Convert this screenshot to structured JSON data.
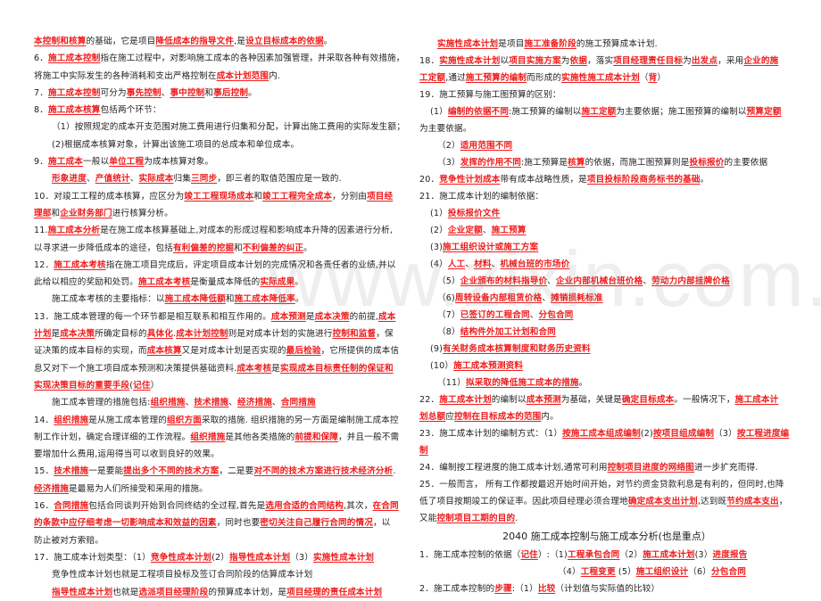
{
  "watermark": "www.zixin.com.cn",
  "left_column": [
    {
      "indent": 0,
      "segs": [
        {
          "h": 1,
          "t": "本控制和核算"
        },
        {
          "t": "的基础，它是项目"
        },
        {
          "h": 1,
          "t": "降低成本的指导文件"
        },
        {
          "t": ",是"
        },
        {
          "h": 1,
          "t": "设立目标成本的依据"
        },
        {
          "t": "。"
        }
      ]
    },
    {
      "indent": 0,
      "segs": [
        {
          "t": "6．"
        },
        {
          "h": 1,
          "t": "施工成本控制"
        },
        {
          "t": "指在施工过程中，对影响施工成本的各种因素加强管理，并采取各种有效措施，"
        }
      ]
    },
    {
      "indent": 0,
      "segs": [
        {
          "t": "将施工中实际发生的各种消耗和支出严格控制在"
        },
        {
          "h": 1,
          "t": "成本计划范围"
        },
        {
          "t": "内."
        }
      ]
    },
    {
      "indent": 0,
      "segs": [
        {
          "t": "7．"
        },
        {
          "h": 1,
          "t": "施工成本控制"
        },
        {
          "t": "可分为"
        },
        {
          "h": 1,
          "t": "事先控制"
        },
        {
          "t": "、"
        },
        {
          "h": 1,
          "t": "事中控制"
        },
        {
          "t": "和"
        },
        {
          "h": 1,
          "t": "事后控制"
        },
        {
          "t": "。"
        }
      ]
    },
    {
      "indent": 0,
      "segs": [
        {
          "t": "8．"
        },
        {
          "h": 1,
          "t": "施工成本核算"
        },
        {
          "t": "包括两个环节："
        }
      ]
    },
    {
      "indent": 1,
      "segs": [
        {
          "t": "（1）按照规定的成本开支范围对施工费用进行归集和分配，计算出施工费用的实际发生额；"
        }
      ]
    },
    {
      "indent": 1,
      "segs": [
        {
          "t": "(2)根据成本核算对象，计算出该施工项目的总成本和单位成本。"
        }
      ]
    },
    {
      "indent": 0,
      "segs": [
        {
          "t": "9．"
        },
        {
          "h": 1,
          "t": "施工成本"
        },
        {
          "t": "一般以"
        },
        {
          "h": 1,
          "t": "单位工程"
        },
        {
          "t": "为成本核算对象。"
        }
      ]
    },
    {
      "indent": 1,
      "segs": [
        {
          "h": 1,
          "t": "形象进度"
        },
        {
          "t": "、"
        },
        {
          "h": 1,
          "t": "产值统计"
        },
        {
          "t": "、"
        },
        {
          "h": 1,
          "t": "实际成本"
        },
        {
          "t": "归集"
        },
        {
          "h": 1,
          "t": "三同步"
        },
        {
          "t": "，即三者的取值范围应是一致的."
        }
      ]
    },
    {
      "indent": 0,
      "segs": [
        {
          "t": "10．对竣工工程的成本核算，应区分为"
        },
        {
          "h": 1,
          "t": "竣工工程现场成本"
        },
        {
          "t": "和"
        },
        {
          "h": 1,
          "t": "竣工工程完全成本"
        },
        {
          "t": "，分别由"
        },
        {
          "h": 1,
          "t": "项目经"
        }
      ]
    },
    {
      "indent": 0,
      "segs": [
        {
          "h": 1,
          "t": "理部"
        },
        {
          "t": "和"
        },
        {
          "h": 1,
          "t": "企业财务部门"
        },
        {
          "t": "进行核算分析。"
        }
      ]
    },
    {
      "indent": 0,
      "segs": [
        {
          "t": "11."
        },
        {
          "h": 1,
          "t": "施工成本分析"
        },
        {
          "t": "是在施工成本核算基础上,对成本的形成过程和影响成本升降的因素进行分析,"
        }
      ]
    },
    {
      "indent": 0,
      "segs": [
        {
          "t": "以寻求进一步降低成本的途径，包括"
        },
        {
          "h": 1,
          "t": "有利偏差的挖掘"
        },
        {
          "t": "和"
        },
        {
          "h": 1,
          "t": "不利偏差的纠正"
        },
        {
          "t": "。"
        }
      ]
    },
    {
      "indent": 0,
      "segs": [
        {
          "t": "12．"
        },
        {
          "h": 1,
          "t": "施工成本考核"
        },
        {
          "t": "指在施工项目完成后，评定项目成本计划的完成情况和各责任者的业绩,并以"
        }
      ]
    },
    {
      "indent": 0,
      "segs": [
        {
          "t": "此给以相应的奖励和处罚。"
        },
        {
          "h": 1,
          "t": "施工成本考核"
        },
        {
          "t": "是衡量成本降低的"
        },
        {
          "h": 1,
          "t": "实际成果"
        },
        {
          "t": "。"
        }
      ]
    },
    {
      "indent": 1,
      "segs": [
        {
          "t": "施工成本考核的主要指标：以"
        },
        {
          "h": 1,
          "t": "施工成本降低额"
        },
        {
          "t": "和"
        },
        {
          "h": 1,
          "t": "施工成本降低率"
        },
        {
          "t": "。"
        }
      ]
    },
    {
      "indent": 0,
      "segs": [
        {
          "t": "13．施工成本管理的每一个环节都是相互联系和相互作用的。"
        },
        {
          "h": 1,
          "t": "成本预测"
        },
        {
          "t": "是"
        },
        {
          "h": 1,
          "t": "成本决策"
        },
        {
          "t": "的前提,"
        },
        {
          "h": 1,
          "t": "成本"
        }
      ]
    },
    {
      "indent": 0,
      "segs": [
        {
          "h": 1,
          "t": "计划"
        },
        {
          "t": "是"
        },
        {
          "h": 1,
          "t": "成本决策"
        },
        {
          "t": "所确定目标的"
        },
        {
          "h": 1,
          "t": "具体化"
        },
        {
          "t": "."
        },
        {
          "h": 1,
          "t": "成本计划控制"
        },
        {
          "t": "则是对成本计划的实施进行"
        },
        {
          "h": 1,
          "t": "控制和监督"
        },
        {
          "t": "，保"
        }
      ]
    },
    {
      "indent": 0,
      "segs": [
        {
          "t": "证决策的成本目标的实现，而"
        },
        {
          "h": 1,
          "t": "成本核算"
        },
        {
          "t": "又是对成本计划是否实现的"
        },
        {
          "h": 1,
          "t": "最后检验"
        },
        {
          "t": "，它所提供的成本信"
        }
      ]
    },
    {
      "indent": 0,
      "segs": [
        {
          "t": "息又对下一个施工项目成本预测和决策提供基础资料."
        },
        {
          "h": 1,
          "t": "成本考核"
        },
        {
          "t": "是"
        },
        {
          "h": 1,
          "t": "实现成本目标责任制的保证和"
        }
      ]
    },
    {
      "indent": 0,
      "segs": [
        {
          "h": 1,
          "t": "实现决策目标的重要手段"
        },
        {
          "t": "("
        },
        {
          "h": 1,
          "t": "记住"
        },
        {
          "t": "）"
        }
      ]
    },
    {
      "indent": 1,
      "segs": [
        {
          "t": "施工成本管理的措施包括:"
        },
        {
          "h": 1,
          "t": "组织措施"
        },
        {
          "t": "、"
        },
        {
          "h": 1,
          "t": "技术措施"
        },
        {
          "t": "、"
        },
        {
          "h": 1,
          "t": "经济措施"
        },
        {
          "t": "、"
        },
        {
          "h": 1,
          "t": "合同措施"
        }
      ]
    },
    {
      "indent": 0,
      "segs": [
        {
          "t": "14．"
        },
        {
          "h": 1,
          "t": "组织措施"
        },
        {
          "t": "是从施工成本管理的"
        },
        {
          "h": 1,
          "t": "组织方面"
        },
        {
          "t": "采取的措施. 组织措施的另一方面是编制施工成本控"
        }
      ]
    },
    {
      "indent": 0,
      "segs": [
        {
          "t": "制工作计划，确定合理详细的工作流程。"
        },
        {
          "h": 1,
          "t": "组织措施"
        },
        {
          "t": "是其他各类措施的"
        },
        {
          "h": 1,
          "t": "前提和保障"
        },
        {
          "t": "，并且一般不需"
        }
      ]
    },
    {
      "indent": 0,
      "segs": [
        {
          "t": "要增加什么费用,运用得当可以收到良好的效果。"
        }
      ]
    },
    {
      "indent": 0,
      "segs": [
        {
          "t": "15．"
        },
        {
          "h": 1,
          "t": "技术措施"
        },
        {
          "t": "一是要能"
        },
        {
          "h": 1,
          "t": "提出多个不同的技术方案"
        },
        {
          "t": "，二是要"
        },
        {
          "h": 1,
          "t": "对不同的技术方案进行技术经济分析"
        },
        {
          "t": "."
        }
      ]
    },
    {
      "indent": 0,
      "segs": [
        {
          "h": 1,
          "t": "经济措施"
        },
        {
          "t": "是最易为人们所接受和采用的措施。"
        }
      ]
    },
    {
      "indent": 0,
      "segs": [
        {
          "t": "16．"
        },
        {
          "h": 1,
          "t": "合同措施"
        },
        {
          "t": "包括合同谈判开始到合同终结的全过程,首先是"
        },
        {
          "h": 1,
          "t": "选用合适的合同结构"
        },
        {
          "t": ",其次，"
        },
        {
          "h": 1,
          "t": "在合同"
        }
      ]
    },
    {
      "indent": 0,
      "segs": [
        {
          "h": 1,
          "t": "的条款中应仔细考虑一切影响成本和效益的因素"
        },
        {
          "t": "，同时也要"
        },
        {
          "h": 1,
          "t": "密切关注自己履行合同的情况"
        },
        {
          "t": "，以"
        }
      ]
    },
    {
      "indent": 0,
      "segs": [
        {
          "t": "防止被对方索赔。"
        }
      ]
    },
    {
      "indent": 0,
      "segs": [
        {
          "t": "17．施工成本计划类型：（1）"
        },
        {
          "h": 1,
          "t": "竞争性成本计划"
        },
        {
          "t": "(2）"
        },
        {
          "h": 1,
          "t": "指导性成本计划"
        },
        {
          "t": "（3）"
        },
        {
          "h": 1,
          "t": "实施性成本计划"
        }
      ]
    },
    {
      "indent": 1,
      "segs": [
        {
          "t": "竞争性成本计划也就是工程项目投标及签订合同阶段的估算成本计划"
        }
      ]
    },
    {
      "indent": 1,
      "segs": [
        {
          "h": 1,
          "t": "指导性成本计划"
        },
        {
          "t": "也就是"
        },
        {
          "h": 1,
          "t": "选派项目经理阶段"
        },
        {
          "t": "的预算成本计划，是"
        },
        {
          "h": 1,
          "t": "项目经理的责任成本计划"
        }
      ]
    }
  ],
  "right_column": [
    {
      "indent": 1,
      "segs": [
        {
          "h": 1,
          "t": "实施性成本计划"
        },
        {
          "t": "是项目"
        },
        {
          "h": 1,
          "t": "施工准备阶段"
        },
        {
          "t": "的施工预算成本计划."
        }
      ]
    },
    {
      "indent": 0,
      "segs": [
        {
          "t": "18．"
        },
        {
          "h": 1,
          "t": "实施性成本计划"
        },
        {
          "t": "以"
        },
        {
          "h": 1,
          "t": "项目实施方案"
        },
        {
          "t": "为"
        },
        {
          "h": 1,
          "t": "依据"
        },
        {
          "t": "，落实"
        },
        {
          "h": 1,
          "t": "项目经理责任目标"
        },
        {
          "t": "为"
        },
        {
          "h": 1,
          "t": "出发点"
        },
        {
          "t": "，采用"
        },
        {
          "h": 1,
          "t": "企业的施"
        }
      ]
    },
    {
      "indent": 0,
      "segs": [
        {
          "h": 1,
          "t": "工定额"
        },
        {
          "t": ",通过"
        },
        {
          "h": 1,
          "t": "施工预算的编制"
        },
        {
          "t": "而形成的"
        },
        {
          "h": 1,
          "t": "实施性施工成本计划"
        },
        {
          "t": "（"
        },
        {
          "h": 1,
          "t": "背"
        },
        {
          "t": "）"
        }
      ]
    },
    {
      "indent": 0,
      "segs": [
        {
          "t": "19．施工预算与施工图预算的区别："
        }
      ]
    },
    {
      "indent": 2,
      "segs": [
        {
          "t": "(1）"
        },
        {
          "h": 1,
          "t": "编制的依据不同"
        },
        {
          "t": ":施工预算的编制以"
        },
        {
          "h": 1,
          "t": "施工定额"
        },
        {
          "t": "为主要依据；施工图预算的编制以"
        },
        {
          "h": 1,
          "t": "预算定额"
        }
      ]
    },
    {
      "indent": 0,
      "segs": [
        {
          "t": "为主要依据。"
        }
      ]
    },
    {
      "indent": 3,
      "segs": [
        {
          "t": "（2）"
        },
        {
          "h": 1,
          "t": "适用范围不同"
        }
      ]
    },
    {
      "indent": 3,
      "segs": [
        {
          "t": "（3）"
        },
        {
          "h": 1,
          "t": "发挥的作用不同"
        },
        {
          "t": ":施工预算是"
        },
        {
          "h": 1,
          "t": "核算"
        },
        {
          "t": "的依据，而施工图预算则是"
        },
        {
          "h": 1,
          "t": "投标报价"
        },
        {
          "t": "的主要依据"
        }
      ]
    },
    {
      "indent": 0,
      "segs": [
        {
          "t": "20．"
        },
        {
          "h": 1,
          "t": "竞争性计划成本"
        },
        {
          "t": "带有成本战略性质，是"
        },
        {
          "h": 1,
          "t": "项目投标阶段商务标书的基础"
        },
        {
          "t": "。"
        }
      ]
    },
    {
      "indent": 0,
      "segs": [
        {
          "t": "21．施工成本计划的编制依据："
        }
      ]
    },
    {
      "indent": 2,
      "segs": [
        {
          "t": "(1）"
        },
        {
          "h": 1,
          "t": "投标报价文件"
        }
      ]
    },
    {
      "indent": 2,
      "segs": [
        {
          "t": "(2）"
        },
        {
          "h": 1,
          "t": "企业定额"
        },
        {
          "t": "、"
        },
        {
          "h": 1,
          "t": "施工预算"
        }
      ]
    },
    {
      "indent": 2,
      "segs": [
        {
          "t": "(3)"
        },
        {
          "h": 1,
          "t": "施工组织设计或施工方案"
        }
      ]
    },
    {
      "indent": 2,
      "segs": [
        {
          "t": "(4）"
        },
        {
          "h": 1,
          "t": "人工"
        },
        {
          "t": "、"
        },
        {
          "h": 1,
          "t": "材料"
        },
        {
          "t": "、"
        },
        {
          "h": 1,
          "t": "机械台班的市场价"
        }
      ]
    },
    {
      "indent": 3,
      "segs": [
        {
          "t": "（5）"
        },
        {
          "h": 1,
          "t": "企业颁布的材料指导价"
        },
        {
          "t": "、"
        },
        {
          "h": 1,
          "t": "企业内部机械台班价格"
        },
        {
          "t": "、"
        },
        {
          "h": 1,
          "t": "劳动力内部挂牌价格"
        }
      ]
    },
    {
      "indent": 3,
      "segs": [
        {
          "t": "（6)"
        },
        {
          "h": 1,
          "t": "周转设备内部租赁价格"
        },
        {
          "t": "、"
        },
        {
          "h": 1,
          "t": "摊销损耗标准"
        }
      ]
    },
    {
      "indent": 3,
      "segs": [
        {
          "t": "（7）"
        },
        {
          "h": 1,
          "t": "已签订的工程合同"
        },
        {
          "t": "、"
        },
        {
          "h": 1,
          "t": "分包合同"
        }
      ]
    },
    {
      "indent": 3,
      "segs": [
        {
          "t": "（8）"
        },
        {
          "h": 1,
          "t": "结构件外加工计划和合同"
        }
      ]
    },
    {
      "indent": 2,
      "segs": [
        {
          "t": "(9)"
        },
        {
          "h": 1,
          "t": "有关财务成本核算制度和财务历史资料"
        }
      ]
    },
    {
      "indent": 2,
      "segs": [
        {
          "t": "(10）"
        },
        {
          "h": 1,
          "t": "施工成本预测资料"
        }
      ]
    },
    {
      "indent": 3,
      "segs": [
        {
          "t": "（11）"
        },
        {
          "h": 1,
          "t": "拟采取的降低施工成本的措施"
        },
        {
          "t": "。"
        }
      ]
    },
    {
      "indent": 0,
      "segs": [
        {
          "t": "22．"
        },
        {
          "h": 1,
          "t": "施工成本计划"
        },
        {
          "t": "的编制以"
        },
        {
          "h": 1,
          "t": "成本预测"
        },
        {
          "t": "为基础，关键是"
        },
        {
          "h": 1,
          "t": "确定目标成本"
        },
        {
          "t": "。一般情况下，"
        },
        {
          "h": 1,
          "t": "施工成本计"
        }
      ]
    },
    {
      "indent": 0,
      "segs": [
        {
          "h": 1,
          "t": "划总额"
        },
        {
          "t": "应"
        },
        {
          "h": 1,
          "t": "控制在目标成本的范围"
        },
        {
          "t": "内。"
        }
      ]
    },
    {
      "indent": 0,
      "segs": [
        {
          "t": "23．施工成本计划的编制方式：（1）"
        },
        {
          "h": 1,
          "t": "按施工成本组成编制"
        },
        {
          "t": "(2)"
        },
        {
          "h": 1,
          "t": "按项目组成编制"
        },
        {
          "t": "（3）"
        },
        {
          "h": 1,
          "t": "按工程进度编"
        }
      ]
    },
    {
      "indent": 0,
      "segs": [
        {
          "h": 1,
          "t": "制"
        }
      ]
    },
    {
      "indent": 0,
      "segs": [
        {
          "t": "24．编制按工程进度的施工成本计划,通常可利用"
        },
        {
          "h": 1,
          "t": "控制项目进度的网络图"
        },
        {
          "t": "进一步扩充而得."
        }
      ]
    },
    {
      "indent": 0,
      "segs": [
        {
          "t": "25．一般而言，  所有工作都按最迟开始时间开始，对节约资金贷款利息是有利的，但同时,也降"
        }
      ]
    },
    {
      "indent": 0,
      "segs": [
        {
          "t": "低了项目按期竣工的保证率。因此项目经理必须合理地"
        },
        {
          "h": 1,
          "t": "确定成本支出计划"
        },
        {
          "t": ",达到既"
        },
        {
          "h": 1,
          "t": "节约成本支出"
        },
        {
          "t": "，"
        }
      ]
    },
    {
      "indent": 0,
      "segs": [
        {
          "t": "又能"
        },
        {
          "h": 1,
          "t": "控制项目工期的目的"
        },
        {
          "t": "."
        }
      ]
    }
  ],
  "section": {
    "heading": "2040  施工成本控制与施工成本分析(也是重点）",
    "lines": [
      {
        "indent": 0,
        "segs": [
          {
            "t": "1．施工成本控制的依据（"
          },
          {
            "h": 1,
            "t": "记住"
          },
          {
            "t": "）:（1)"
          },
          {
            "h": 1,
            "t": "工程承包合同"
          },
          {
            "t": "（2）"
          },
          {
            "h": 1,
            "t": "施工成本计划"
          },
          {
            "t": "(3）"
          },
          {
            "h": 1,
            "t": "进度报告"
          }
        ]
      },
      {
        "indent": 4,
        "segs": [
          {
            "t": "（4）"
          },
          {
            "h": 1,
            "t": "工程变更"
          },
          {
            "t": "       (5）"
          },
          {
            "h": 1,
            "t": "施工组织设计"
          },
          {
            "t": "（6）"
          },
          {
            "h": 1,
            "t": "分包合同"
          }
        ]
      },
      {
        "indent": 0,
        "segs": [
          {
            "t": "2．施工成本控制的"
          },
          {
            "h": 1,
            "t": "步骤"
          },
          {
            "t": ":（1）"
          },
          {
            "h": 1,
            "t": "比较"
          },
          {
            "t": "（计划值与实际值的比较）"
          }
        ]
      }
    ]
  }
}
